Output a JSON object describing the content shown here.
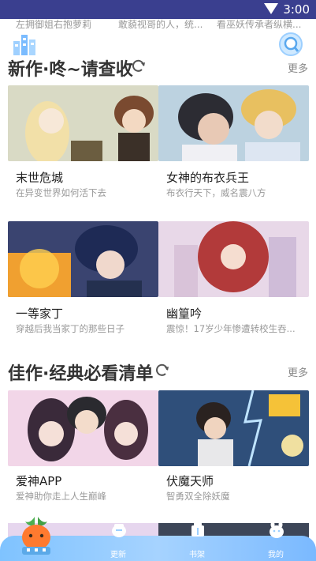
{
  "status_bar": {
    "time": "3:00"
  },
  "previous_row": {
    "items": [
      "左拥御姐右抱萝莉",
      "敢藐视哥的人，统...",
      "看巫妖传承者纵横..."
    ]
  },
  "sections": [
    {
      "title": "新作·咚~请查收",
      "more": "更多",
      "cards": [
        {
          "name": "末世危城",
          "desc": "在异变世界如何活下去"
        },
        {
          "name": "女神的布衣兵王",
          "desc": "布衣行天下，威名震八方"
        },
        {
          "name": "一等家丁",
          "desc": "穿越后我当家丁的那些日子"
        },
        {
          "name": "幽篁吟",
          "desc": "震惊！17岁少年惨遭转校生吞..."
        }
      ]
    },
    {
      "title": "佳作·经典必看清单",
      "more": "更多",
      "cards": [
        {
          "name": "爱神APP",
          "desc": "爱神助你走上人生巅峰"
        },
        {
          "name": "伏魔天师",
          "desc": "智勇双全除妖魔"
        }
      ]
    }
  ],
  "bottom_nav": {
    "items": [
      {
        "label": "",
        "icon": "carrot-home-icon"
      },
      {
        "label": "更新",
        "icon": "update-icon"
      },
      {
        "label": "书架",
        "icon": "bookshelf-icon"
      },
      {
        "label": "我的",
        "icon": "profile-icon"
      }
    ]
  },
  "colors": {
    "status_bar": "#3a3f8f",
    "nav": "#8cc8ff",
    "title": "#333333",
    "desc": "#999999"
  }
}
